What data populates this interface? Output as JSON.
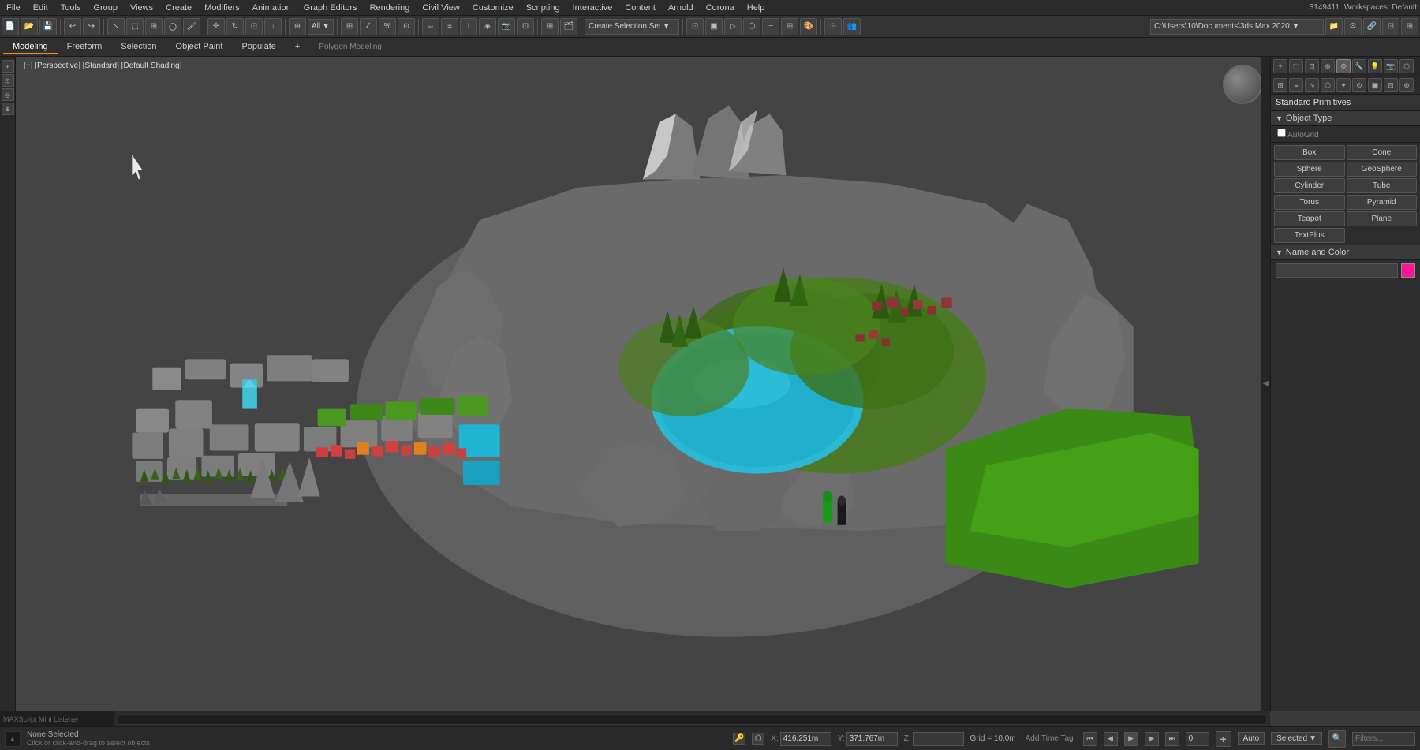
{
  "menu": {
    "items": [
      "File",
      "Edit",
      "Tools",
      "Group",
      "Views",
      "Create",
      "Modifiers",
      "Animation",
      "Graph Editors",
      "Rendering",
      "Civil View",
      "Customize",
      "Scripting",
      "Interactive",
      "Content",
      "Arnold",
      "Corona",
      "Help"
    ]
  },
  "toolbar1": {
    "all_label": "All",
    "create_selection_set": "Create Selection Set",
    "path_value": "C:\\Users\\10\\Documents\\3ds Max 2020 ▼",
    "id_value": "3149411",
    "workspace_label": "Workspaces: Default"
  },
  "tabs": {
    "items": [
      "Modeling",
      "Freeform",
      "Selection",
      "Object Paint",
      "Populate",
      "+"
    ]
  },
  "mode_label": "Polygon Modeling",
  "viewport": {
    "label": "[+] [Perspective] [Standard] [Default Shading]"
  },
  "right_panel": {
    "header": "Standard Primitives",
    "section_object_type": "Object Type",
    "standard_label": "AutoGrid",
    "buttons": [
      {
        "label": "Box",
        "col": 1
      },
      {
        "label": "Cone",
        "col": 2
      },
      {
        "label": "Sphere",
        "col": 1
      },
      {
        "label": "GeoSphere",
        "col": 2
      },
      {
        "label": "Cylinder",
        "col": 1
      },
      {
        "label": "Tube",
        "col": 2
      },
      {
        "label": "Torus",
        "col": 1
      },
      {
        "label": "Pyramid",
        "col": 2
      },
      {
        "label": "Teapot",
        "col": 1
      },
      {
        "label": "Plane",
        "col": 2
      },
      {
        "label": "TextPlus",
        "col": 1
      }
    ],
    "section_name_color": "Name and Color"
  },
  "status": {
    "none_selected": "None Selected",
    "click_instruction": "Click or click-and-drag to select objects",
    "x_label": "X:",
    "x_value": "416.251m",
    "y_label": "Y:",
    "y_value": "371.767m",
    "z_label": "Z:",
    "z_value": "",
    "grid_label": "Grid = 10.0m",
    "add_time_tag": "Add Time Tag",
    "auto_label": "Auto",
    "selected_label": "Selected",
    "filters_label": "Filters..."
  },
  "mini_listener": {
    "label": "MAXScript Mini Listener"
  },
  "icons": {
    "undo": "↩",
    "redo": "↪",
    "select": "↖",
    "move": "✛",
    "rotate": "↻",
    "scale": "⊡",
    "play": "▶",
    "pause": "⏸",
    "stop": "■",
    "prev": "⏮",
    "next": "⏭",
    "chevron_left": "◀",
    "chevron_right": "▶",
    "chevron_down": "▼",
    "expand": "►"
  }
}
